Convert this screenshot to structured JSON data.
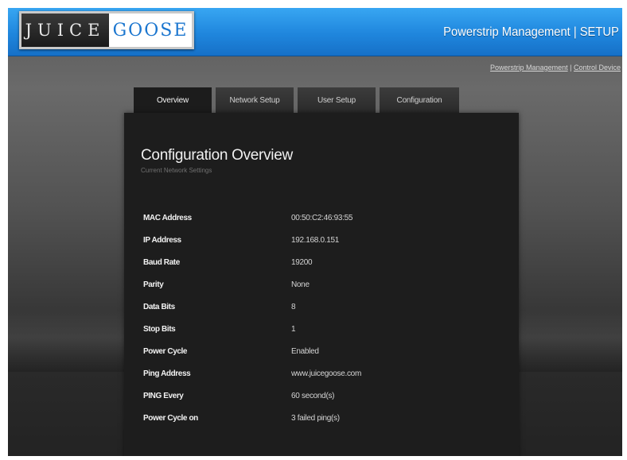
{
  "logo": {
    "left_text": "JUICE",
    "right_text": "GOOSE"
  },
  "header": {
    "title": "Powerstrip Management | SETUP"
  },
  "breadcrumb": {
    "link1": "Powerstrip Management",
    "separator": "|",
    "link2": "Control Device"
  },
  "tabs": [
    {
      "label": "Overview",
      "active": true
    },
    {
      "label": "Network Setup",
      "active": false
    },
    {
      "label": "User Setup",
      "active": false
    },
    {
      "label": "Configuration",
      "active": false
    }
  ],
  "panel": {
    "title": "Configuration Overview",
    "subtitle": "Current Network Settings"
  },
  "settings": [
    {
      "label": "MAC Address",
      "value": "00:50:C2:46:93:55"
    },
    {
      "label": "IP Address",
      "value": "192.168.0.151"
    },
    {
      "label": "Baud Rate",
      "value": "19200"
    },
    {
      "label": "Parity",
      "value": "None"
    },
    {
      "label": "Data Bits",
      "value": "8"
    },
    {
      "label": "Stop Bits",
      "value": "1"
    },
    {
      "label": "Power Cycle",
      "value": "Enabled"
    },
    {
      "label": "Ping Address",
      "value": "www.juicegoose.com"
    },
    {
      "label": "PING Every",
      "value": "60 second(s)"
    },
    {
      "label": "Power Cycle on",
      "value": "3 failed ping(s)"
    }
  ],
  "colors": {
    "header_blue": "#1f86dd",
    "panel_bg": "#1d1d1d",
    "logo_blue": "#1b76cf"
  }
}
